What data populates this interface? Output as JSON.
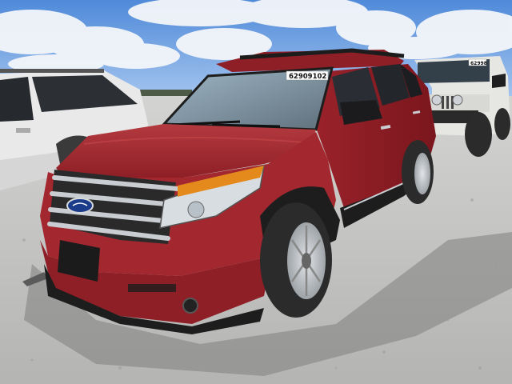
{
  "photo": {
    "windshield_sticker": "62909102",
    "jeep_sticker": "62998",
    "colors": {
      "sky": "#5d95e0",
      "sky_light": "#a9c8f0",
      "cloud": "#f4f6fa",
      "gravel": "#bcbcbc",
      "gravel_dark": "#8e8e8e",
      "body_red": "#a3272f",
      "body_red_dark": "#6d1419",
      "body_red_light": "#c6474b",
      "trim_black": "#1d1d1d",
      "chrome": "#c9ccd0",
      "headlight_amber": "#e48a1c",
      "white_suv": "#e9e9ea",
      "jeep_white": "#e6e6e2",
      "tire": "#2b2b2b",
      "wheel_silver": "#bfc3c7"
    },
    "icons": [
      "ford-oval-logo-icon"
    ]
  }
}
